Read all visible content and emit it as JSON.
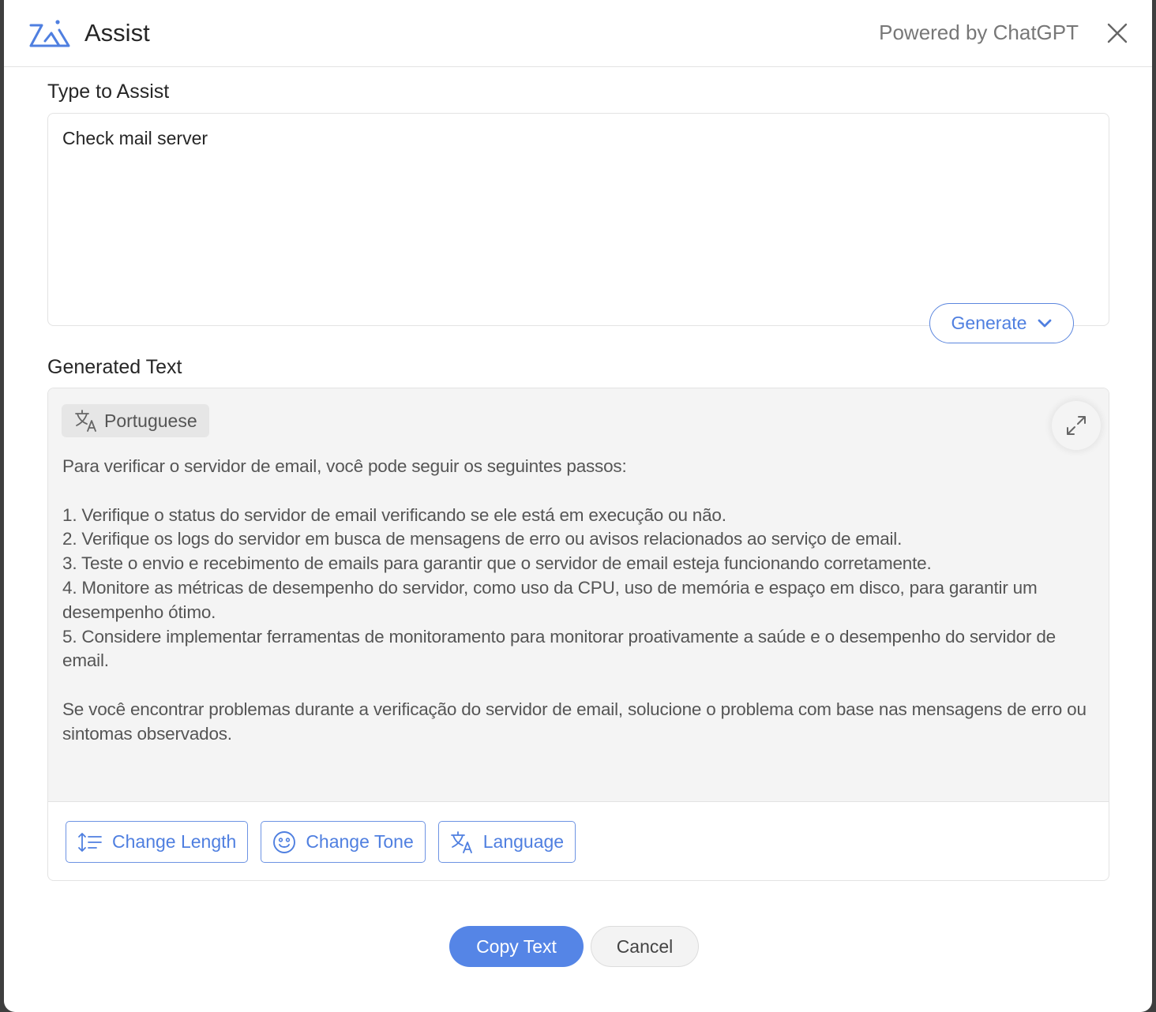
{
  "header": {
    "logo": "zia-logo-icon",
    "title": "Assist",
    "powered_by": "Powered by ChatGPT",
    "close_icon": "close-icon"
  },
  "input_section": {
    "label": "Type to Assist",
    "value": "Check mail server",
    "generate_label": "Generate",
    "generate_icon": "chevron-down-icon"
  },
  "generated_section": {
    "label": "Generated Text",
    "language_chip": "Portuguese",
    "language_icon": "translate-icon",
    "expand_icon": "expand-icon",
    "text": "Para verificar o servidor de email, você pode seguir os seguintes passos:\n\n1. Verifique o status do servidor de email verificando se ele está em execução ou não.\n2. Verifique os logs do servidor em busca de mensagens de erro ou avisos relacionados ao serviço de email.\n3. Teste o envio e recebimento de emails para garantir que o servidor de email esteja funcionando corretamente.\n4. Monitore as métricas de desempenho do servidor, como uso da CPU, uso de memória e espaço em disco, para garantir um desempenho ótimo.\n5. Considere implementar ferramentas de monitoramento para monitorar proativamente a saúde e o desempenho do servidor de email.\n\nSe você encontrar problemas durante a verificação do servidor de email, solucione o problema com base nas mensagens de erro ou sintomas observados.",
    "actions": [
      {
        "label": "Change Length",
        "icon": "text-length-icon"
      },
      {
        "label": "Change Tone",
        "icon": "smiley-icon"
      },
      {
        "label": "Language",
        "icon": "translate-icon"
      }
    ]
  },
  "footer": {
    "copy_label": "Copy Text",
    "cancel_label": "Cancel"
  },
  "colors": {
    "accent": "#5585e6",
    "panel_bg": "#f4f4f4",
    "text": "#262626"
  }
}
